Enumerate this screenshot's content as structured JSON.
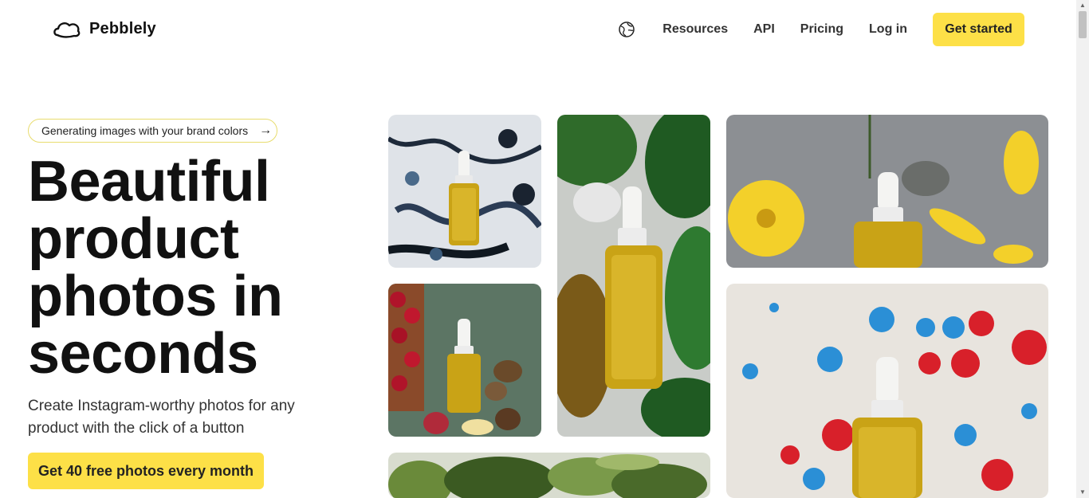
{
  "brand": {
    "name": "Pebblely",
    "logo_icon": "cloud-pebble-icon"
  },
  "nav": {
    "language_icon": "globe-icon",
    "links": [
      "Resources",
      "API",
      "Pricing",
      "Log in"
    ],
    "cta_label": "Get started",
    "accent": "#fde047"
  },
  "hero": {
    "pill_text": "Generating images with your brand colors",
    "pill_arrow": "→",
    "title": "Beautiful product photos in seconds",
    "subtitle": "Create Instagram-worthy photos for any product with the click of a button",
    "cta_label": "Get 40 free photos every month"
  },
  "gallery": [
    {
      "scene": "black and blue marble splatter with serum bottle"
    },
    {
      "scene": "green monstera leaves and water with serum bottle"
    },
    {
      "scene": "grey stone with yellow flowers and serum bottle"
    },
    {
      "scene": "green stone with fruits and nuts and serum bottle"
    },
    {
      "scene": "red and blue paint drops with serum bottle"
    },
    {
      "scene": "green foliage"
    }
  ]
}
